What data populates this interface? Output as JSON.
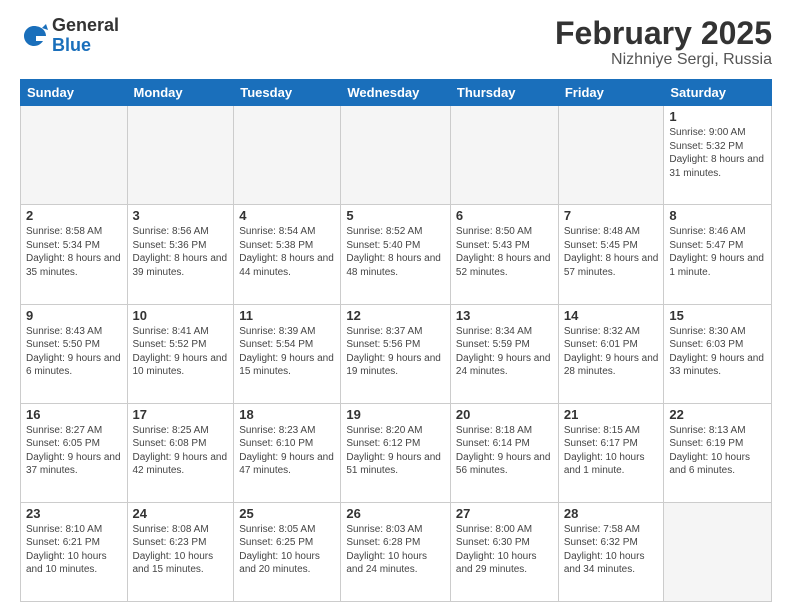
{
  "logo": {
    "general": "General",
    "blue": "Blue"
  },
  "title": "February 2025",
  "subtitle": "Nizhniye Sergi, Russia",
  "days_of_week": [
    "Sunday",
    "Monday",
    "Tuesday",
    "Wednesday",
    "Thursday",
    "Friday",
    "Saturday"
  ],
  "weeks": [
    [
      {
        "day": "",
        "info": ""
      },
      {
        "day": "",
        "info": ""
      },
      {
        "day": "",
        "info": ""
      },
      {
        "day": "",
        "info": ""
      },
      {
        "day": "",
        "info": ""
      },
      {
        "day": "",
        "info": ""
      },
      {
        "day": "1",
        "info": "Sunrise: 9:00 AM\nSunset: 5:32 PM\nDaylight: 8 hours and 31 minutes."
      }
    ],
    [
      {
        "day": "2",
        "info": "Sunrise: 8:58 AM\nSunset: 5:34 PM\nDaylight: 8 hours and 35 minutes."
      },
      {
        "day": "3",
        "info": "Sunrise: 8:56 AM\nSunset: 5:36 PM\nDaylight: 8 hours and 39 minutes."
      },
      {
        "day": "4",
        "info": "Sunrise: 8:54 AM\nSunset: 5:38 PM\nDaylight: 8 hours and 44 minutes."
      },
      {
        "day": "5",
        "info": "Sunrise: 8:52 AM\nSunset: 5:40 PM\nDaylight: 8 hours and 48 minutes."
      },
      {
        "day": "6",
        "info": "Sunrise: 8:50 AM\nSunset: 5:43 PM\nDaylight: 8 hours and 52 minutes."
      },
      {
        "day": "7",
        "info": "Sunrise: 8:48 AM\nSunset: 5:45 PM\nDaylight: 8 hours and 57 minutes."
      },
      {
        "day": "8",
        "info": "Sunrise: 8:46 AM\nSunset: 5:47 PM\nDaylight: 9 hours and 1 minute."
      }
    ],
    [
      {
        "day": "9",
        "info": "Sunrise: 8:43 AM\nSunset: 5:50 PM\nDaylight: 9 hours and 6 minutes."
      },
      {
        "day": "10",
        "info": "Sunrise: 8:41 AM\nSunset: 5:52 PM\nDaylight: 9 hours and 10 minutes."
      },
      {
        "day": "11",
        "info": "Sunrise: 8:39 AM\nSunset: 5:54 PM\nDaylight: 9 hours and 15 minutes."
      },
      {
        "day": "12",
        "info": "Sunrise: 8:37 AM\nSunset: 5:56 PM\nDaylight: 9 hours and 19 minutes."
      },
      {
        "day": "13",
        "info": "Sunrise: 8:34 AM\nSunset: 5:59 PM\nDaylight: 9 hours and 24 minutes."
      },
      {
        "day": "14",
        "info": "Sunrise: 8:32 AM\nSunset: 6:01 PM\nDaylight: 9 hours and 28 minutes."
      },
      {
        "day": "15",
        "info": "Sunrise: 8:30 AM\nSunset: 6:03 PM\nDaylight: 9 hours and 33 minutes."
      }
    ],
    [
      {
        "day": "16",
        "info": "Sunrise: 8:27 AM\nSunset: 6:05 PM\nDaylight: 9 hours and 37 minutes."
      },
      {
        "day": "17",
        "info": "Sunrise: 8:25 AM\nSunset: 6:08 PM\nDaylight: 9 hours and 42 minutes."
      },
      {
        "day": "18",
        "info": "Sunrise: 8:23 AM\nSunset: 6:10 PM\nDaylight: 9 hours and 47 minutes."
      },
      {
        "day": "19",
        "info": "Sunrise: 8:20 AM\nSunset: 6:12 PM\nDaylight: 9 hours and 51 minutes."
      },
      {
        "day": "20",
        "info": "Sunrise: 8:18 AM\nSunset: 6:14 PM\nDaylight: 9 hours and 56 minutes."
      },
      {
        "day": "21",
        "info": "Sunrise: 8:15 AM\nSunset: 6:17 PM\nDaylight: 10 hours and 1 minute."
      },
      {
        "day": "22",
        "info": "Sunrise: 8:13 AM\nSunset: 6:19 PM\nDaylight: 10 hours and 6 minutes."
      }
    ],
    [
      {
        "day": "23",
        "info": "Sunrise: 8:10 AM\nSunset: 6:21 PM\nDaylight: 10 hours and 10 minutes."
      },
      {
        "day": "24",
        "info": "Sunrise: 8:08 AM\nSunset: 6:23 PM\nDaylight: 10 hours and 15 minutes."
      },
      {
        "day": "25",
        "info": "Sunrise: 8:05 AM\nSunset: 6:25 PM\nDaylight: 10 hours and 20 minutes."
      },
      {
        "day": "26",
        "info": "Sunrise: 8:03 AM\nSunset: 6:28 PM\nDaylight: 10 hours and 24 minutes."
      },
      {
        "day": "27",
        "info": "Sunrise: 8:00 AM\nSunset: 6:30 PM\nDaylight: 10 hours and 29 minutes."
      },
      {
        "day": "28",
        "info": "Sunrise: 7:58 AM\nSunset: 6:32 PM\nDaylight: 10 hours and 34 minutes."
      },
      {
        "day": "",
        "info": ""
      }
    ]
  ]
}
